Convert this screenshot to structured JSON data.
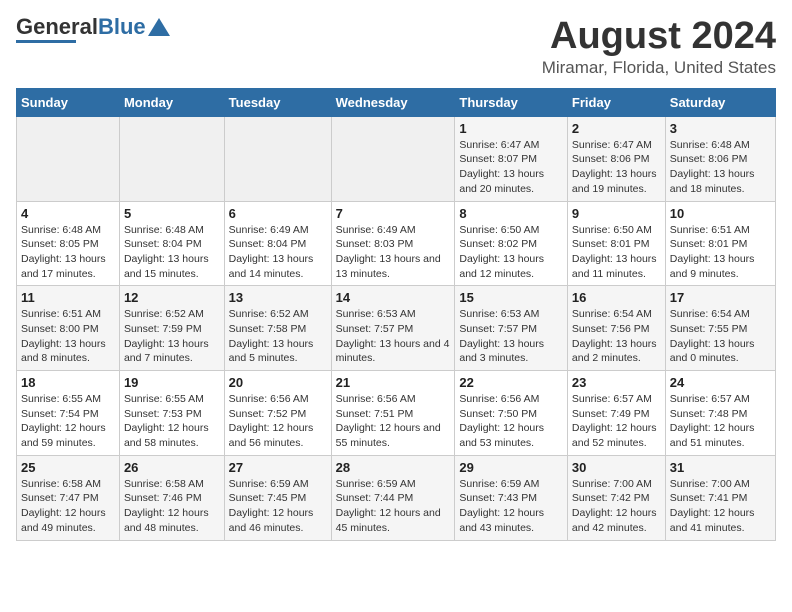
{
  "logo": {
    "general": "General",
    "blue": "Blue"
  },
  "title": "August 2024",
  "subtitle": "Miramar, Florida, United States",
  "days_of_week": [
    "Sunday",
    "Monday",
    "Tuesday",
    "Wednesday",
    "Thursday",
    "Friday",
    "Saturday"
  ],
  "weeks": [
    [
      {
        "day": "",
        "info": ""
      },
      {
        "day": "",
        "info": ""
      },
      {
        "day": "",
        "info": ""
      },
      {
        "day": "",
        "info": ""
      },
      {
        "day": "1",
        "info": "Sunrise: 6:47 AM\nSunset: 8:07 PM\nDaylight: 13 hours and 20 minutes."
      },
      {
        "day": "2",
        "info": "Sunrise: 6:47 AM\nSunset: 8:06 PM\nDaylight: 13 hours and 19 minutes."
      },
      {
        "day": "3",
        "info": "Sunrise: 6:48 AM\nSunset: 8:06 PM\nDaylight: 13 hours and 18 minutes."
      }
    ],
    [
      {
        "day": "4",
        "info": "Sunrise: 6:48 AM\nSunset: 8:05 PM\nDaylight: 13 hours and 17 minutes."
      },
      {
        "day": "5",
        "info": "Sunrise: 6:48 AM\nSunset: 8:04 PM\nDaylight: 13 hours and 15 minutes."
      },
      {
        "day": "6",
        "info": "Sunrise: 6:49 AM\nSunset: 8:04 PM\nDaylight: 13 hours and 14 minutes."
      },
      {
        "day": "7",
        "info": "Sunrise: 6:49 AM\nSunset: 8:03 PM\nDaylight: 13 hours and 13 minutes."
      },
      {
        "day": "8",
        "info": "Sunrise: 6:50 AM\nSunset: 8:02 PM\nDaylight: 13 hours and 12 minutes."
      },
      {
        "day": "9",
        "info": "Sunrise: 6:50 AM\nSunset: 8:01 PM\nDaylight: 13 hours and 11 minutes."
      },
      {
        "day": "10",
        "info": "Sunrise: 6:51 AM\nSunset: 8:01 PM\nDaylight: 13 hours and 9 minutes."
      }
    ],
    [
      {
        "day": "11",
        "info": "Sunrise: 6:51 AM\nSunset: 8:00 PM\nDaylight: 13 hours and 8 minutes."
      },
      {
        "day": "12",
        "info": "Sunrise: 6:52 AM\nSunset: 7:59 PM\nDaylight: 13 hours and 7 minutes."
      },
      {
        "day": "13",
        "info": "Sunrise: 6:52 AM\nSunset: 7:58 PM\nDaylight: 13 hours and 5 minutes."
      },
      {
        "day": "14",
        "info": "Sunrise: 6:53 AM\nSunset: 7:57 PM\nDaylight: 13 hours and 4 minutes."
      },
      {
        "day": "15",
        "info": "Sunrise: 6:53 AM\nSunset: 7:57 PM\nDaylight: 13 hours and 3 minutes."
      },
      {
        "day": "16",
        "info": "Sunrise: 6:54 AM\nSunset: 7:56 PM\nDaylight: 13 hours and 2 minutes."
      },
      {
        "day": "17",
        "info": "Sunrise: 6:54 AM\nSunset: 7:55 PM\nDaylight: 13 hours and 0 minutes."
      }
    ],
    [
      {
        "day": "18",
        "info": "Sunrise: 6:55 AM\nSunset: 7:54 PM\nDaylight: 12 hours and 59 minutes."
      },
      {
        "day": "19",
        "info": "Sunrise: 6:55 AM\nSunset: 7:53 PM\nDaylight: 12 hours and 58 minutes."
      },
      {
        "day": "20",
        "info": "Sunrise: 6:56 AM\nSunset: 7:52 PM\nDaylight: 12 hours and 56 minutes."
      },
      {
        "day": "21",
        "info": "Sunrise: 6:56 AM\nSunset: 7:51 PM\nDaylight: 12 hours and 55 minutes."
      },
      {
        "day": "22",
        "info": "Sunrise: 6:56 AM\nSunset: 7:50 PM\nDaylight: 12 hours and 53 minutes."
      },
      {
        "day": "23",
        "info": "Sunrise: 6:57 AM\nSunset: 7:49 PM\nDaylight: 12 hours and 52 minutes."
      },
      {
        "day": "24",
        "info": "Sunrise: 6:57 AM\nSunset: 7:48 PM\nDaylight: 12 hours and 51 minutes."
      }
    ],
    [
      {
        "day": "25",
        "info": "Sunrise: 6:58 AM\nSunset: 7:47 PM\nDaylight: 12 hours and 49 minutes."
      },
      {
        "day": "26",
        "info": "Sunrise: 6:58 AM\nSunset: 7:46 PM\nDaylight: 12 hours and 48 minutes."
      },
      {
        "day": "27",
        "info": "Sunrise: 6:59 AM\nSunset: 7:45 PM\nDaylight: 12 hours and 46 minutes."
      },
      {
        "day": "28",
        "info": "Sunrise: 6:59 AM\nSunset: 7:44 PM\nDaylight: 12 hours and 45 minutes."
      },
      {
        "day": "29",
        "info": "Sunrise: 6:59 AM\nSunset: 7:43 PM\nDaylight: 12 hours and 43 minutes."
      },
      {
        "day": "30",
        "info": "Sunrise: 7:00 AM\nSunset: 7:42 PM\nDaylight: 12 hours and 42 minutes."
      },
      {
        "day": "31",
        "info": "Sunrise: 7:00 AM\nSunset: 7:41 PM\nDaylight: 12 hours and 41 minutes."
      }
    ]
  ]
}
